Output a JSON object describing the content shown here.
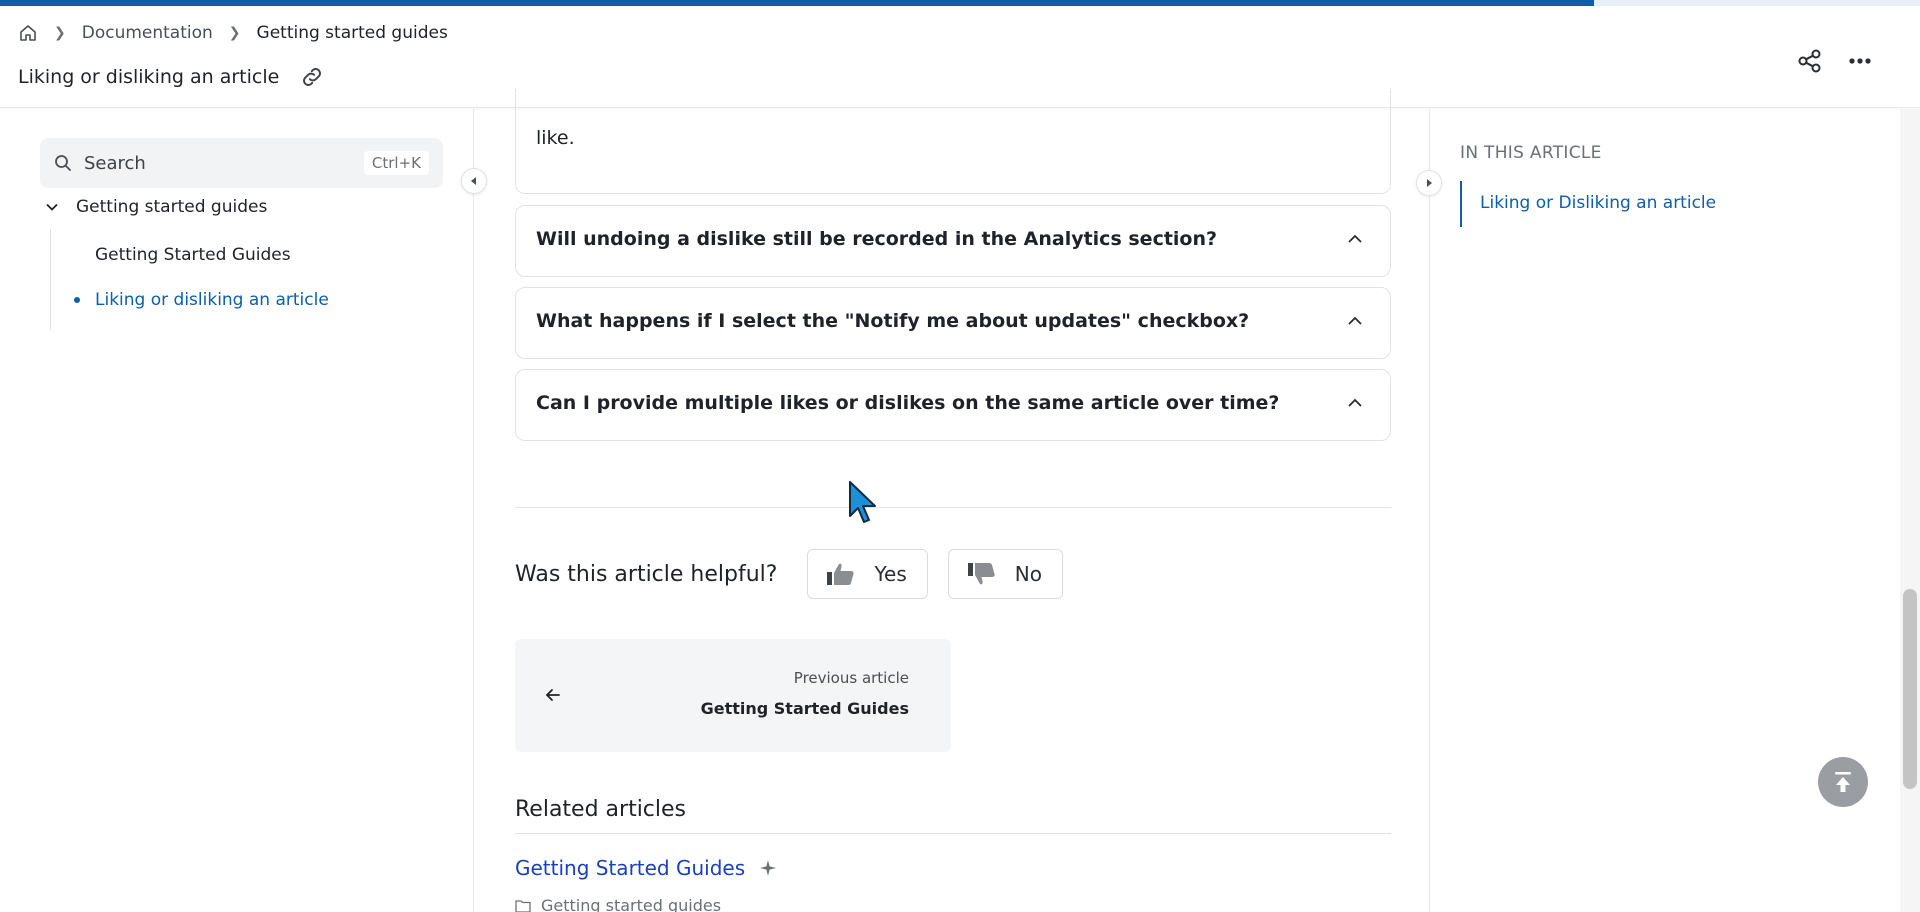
{
  "progress": {
    "percent": 83
  },
  "header": {
    "breadcrumb": [
      "Documentation",
      "Getting started guides"
    ],
    "title": "Liking or disliking an article"
  },
  "sidebar": {
    "search": {
      "placeholder": "Search",
      "shortcut": "Ctrl+K"
    },
    "group_label": "Getting started guides",
    "items": [
      {
        "label": "Getting Started Guides",
        "active": false
      },
      {
        "label": "Liking or disliking an article",
        "active": true
      }
    ]
  },
  "main": {
    "answer_tail": "like.",
    "faqs": [
      {
        "question": "Will undoing a dislike still be recorded in the Analytics section?"
      },
      {
        "question": "What happens if I select the \"Notify me about updates\" checkbox?"
      },
      {
        "question": "Can I provide multiple likes or dislikes on the same article over time?"
      }
    ],
    "helpful": {
      "label": "Was this article helpful?",
      "yes": "Yes",
      "no": "No"
    },
    "previous": {
      "label": "Previous article",
      "title": "Getting Started Guides"
    },
    "related": {
      "heading": "Related articles",
      "items": [
        {
          "title": "Getting Started Guides",
          "category": "Getting started guides"
        }
      ]
    }
  },
  "toc": {
    "heading": "IN THIS ARTICLE",
    "items": [
      "Liking or Disliking an article"
    ]
  },
  "colors": {
    "accent": "#0b5fad",
    "link": "#1a3fbf"
  }
}
